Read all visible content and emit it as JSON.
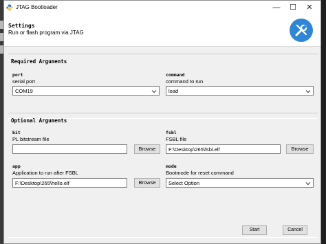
{
  "window": {
    "title": "JTAG Bootloader",
    "min_glyph": "—",
    "max_glyph": "☐",
    "close_glyph": "✕"
  },
  "header": {
    "title": "Settings",
    "subtitle": "Run or flash program via JTAG"
  },
  "required": {
    "title": "Required Arguments",
    "port": {
      "label": "port",
      "description": "serial port",
      "value": "COM19"
    },
    "command": {
      "label": "command",
      "description": "command to run",
      "value": "load"
    }
  },
  "optional": {
    "title": "Optional Arguments",
    "bit": {
      "label": "bit",
      "description": "PL bitstream file",
      "value": "",
      "button": "Browse"
    },
    "fsbl": {
      "label": "fsbl",
      "description": "FSBL file",
      "value": "F:\\Desktop\\265\\fsbl.elf",
      "button": "Browse"
    },
    "app": {
      "label": "app",
      "description": "Application to run after FSBL",
      "value": "F:\\Desktop\\265\\hello.elf",
      "button": "Browse"
    },
    "mode": {
      "label": "mode",
      "description": "Bootmode for reset command",
      "value": "Select Option"
    }
  },
  "footer": {
    "start_label": "Start",
    "cancel_label": "Cancel"
  },
  "colors": {
    "accent": "#2f86d7",
    "panel_bg": "#f0f0f0"
  },
  "icons": {
    "app": "python-icon",
    "header": "tools-icon"
  }
}
